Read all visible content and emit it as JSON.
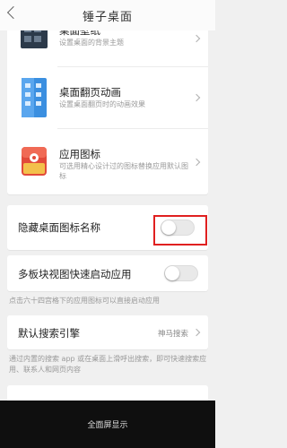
{
  "header": {
    "title": "锤子桌面"
  },
  "card1": {
    "rows": [
      {
        "title": "桌面壁纸",
        "desc": "设置桌面的背景主题"
      },
      {
        "title": "桌面翻页动画",
        "desc": "设置桌面翻页时的动画效果"
      },
      {
        "title": "应用图标",
        "desc": "可选用精心设计过的图标替换应用默认图标"
      }
    ]
  },
  "hide_names": {
    "label": "隐藏桌面图标名称",
    "enabled": false
  },
  "multiboard": {
    "label": "多板块视图快速启动应用",
    "enabled": false,
    "note": "点击六十四宫格下的应用图标可以直接启动应用"
  },
  "search": {
    "label": "默认搜索引擎",
    "value": "神马搜索",
    "note": "通过内置的搜索 app 或在桌面上滑呼出搜索，即可快速搜索应用、联系人和网页内容"
  },
  "bottom_bar": {
    "label": "全面屏显示"
  },
  "colors": {
    "highlight": "#e02020",
    "accent": "#3b8fe0"
  }
}
